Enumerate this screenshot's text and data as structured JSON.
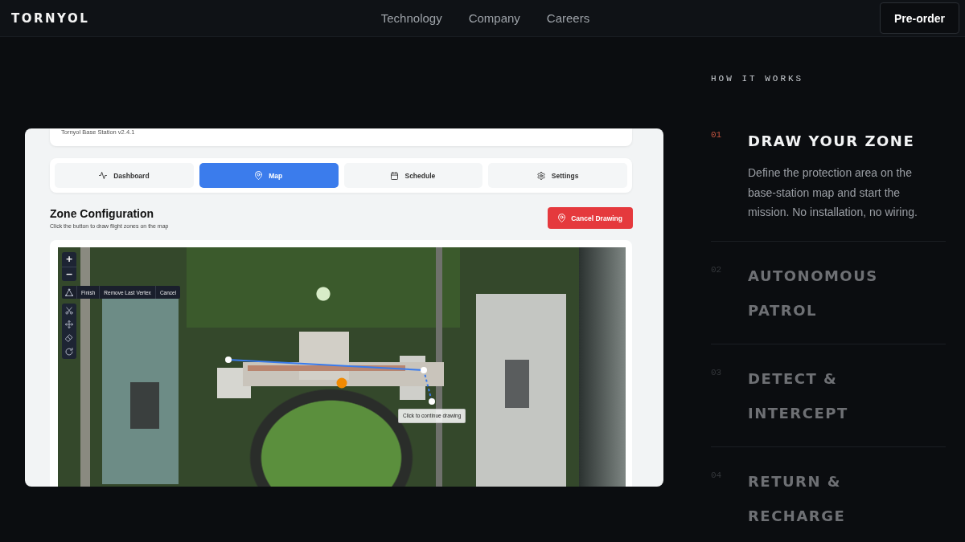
{
  "header": {
    "logo": "TORNYOL",
    "nav": [
      "Technology",
      "Company",
      "Careers"
    ],
    "cta": "Pre-order"
  },
  "app_screenshot": {
    "version_label": "Tornyol Base Station v2.4.1",
    "tabs": [
      {
        "label": "Dashboard",
        "selected": false
      },
      {
        "label": "Map",
        "selected": true
      },
      {
        "label": "Schedule",
        "selected": false
      },
      {
        "label": "Settings",
        "selected": false
      }
    ],
    "section": {
      "title": "Zone Configuration",
      "subtitle": "Click the button to draw flight zones on the map",
      "button": "Cancel Drawing"
    },
    "map": {
      "zoom_in": "+",
      "zoom_out": "−",
      "draw_actions": [
        "Finish",
        "Remove Last Vertex",
        "Cancel"
      ],
      "tooltip": "Click to continue drawing"
    }
  },
  "how_it_works": {
    "heading": "HOW IT WORKS",
    "steps": [
      {
        "number": "01",
        "title": "DRAW YOUR ZONE",
        "description": "Define the protection area on the base-station map and start the mission. No installation, no wiring.",
        "selected": true
      },
      {
        "number": "02",
        "title": "AUTONOMOUS PATROL",
        "selected": false
      },
      {
        "number": "03",
        "title": "DETECT & INTERCEPT",
        "selected": false
      },
      {
        "number": "04",
        "title": "RETURN & RECHARGE",
        "selected": false
      }
    ]
  }
}
